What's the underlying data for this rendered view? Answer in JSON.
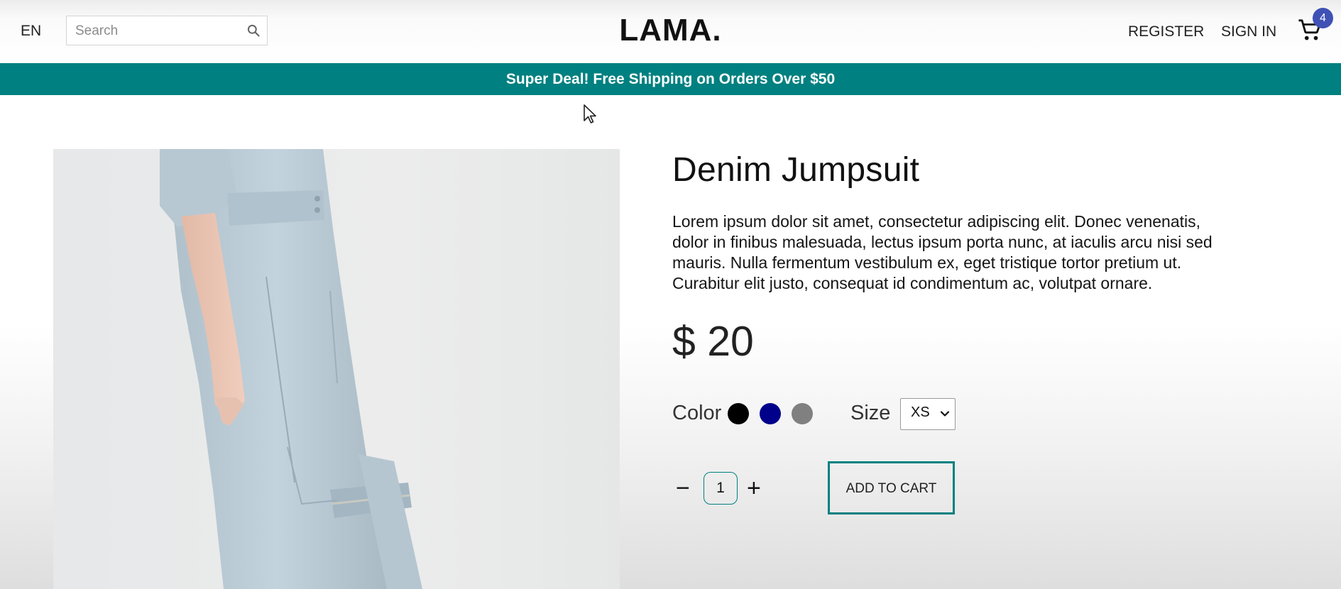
{
  "navbar": {
    "language": "EN",
    "search": {
      "placeholder": "Search",
      "icon": "search-icon"
    },
    "logo": "LAMA.",
    "links": {
      "register": "REGISTER",
      "sign_in": "SIGN IN"
    },
    "cart": {
      "icon": "shopping-cart-icon",
      "count": "4"
    }
  },
  "announcement": "Super Deal! Free Shipping on Orders Over $50",
  "product": {
    "title": "Denim Jumpsuit",
    "description": "Lorem ipsum dolor sit amet, consectetur adipiscing elit. Donec venenatis, dolor in finibus malesuada, lectus ipsum porta nunc, at iaculis arcu nisi sed mauris. Nulla fermentum vestibulum ex, eget tristique tortor pretium ut. Curabitur elit justo, consequat id condimentum ac, volutpat ornare.",
    "price": "$ 20",
    "color_label": "Color",
    "colors": [
      "#000000",
      "#00008b",
      "#808080"
    ],
    "size_label": "Size",
    "size_selected": "XS",
    "quantity": "1",
    "decrease": "−",
    "increase": "+",
    "add_to_cart": "ADD TO CART"
  },
  "theme": {
    "accent": "#008080",
    "badge": "#3f51b5"
  }
}
